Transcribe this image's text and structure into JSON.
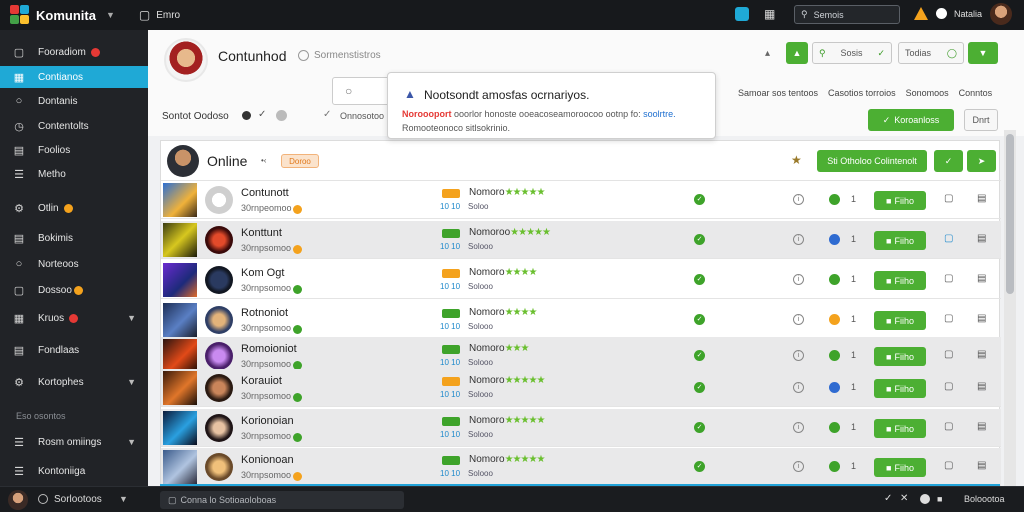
{
  "topbar": {
    "app_title": "Komunita",
    "menu_label": "Emro",
    "search_placeholder": "Semois",
    "user_name": "Natalia"
  },
  "sidebar": {
    "items": [
      {
        "label": "Fooradiom"
      },
      {
        "label": "Contianos"
      },
      {
        "label": "Dontanis"
      },
      {
        "label": "Contentolts"
      },
      {
        "label": "Foolios"
      },
      {
        "label": "Metho"
      },
      {
        "label": "Otlin"
      },
      {
        "label": "Bokimis"
      },
      {
        "label": "Norteoos"
      },
      {
        "label": "Dossoo"
      },
      {
        "label": "Kruos"
      },
      {
        "label": "Fondlaas"
      },
      {
        "label": "Kortophes"
      },
      {
        "label": "Rosm omiings"
      },
      {
        "label": "Kontoniiga"
      }
    ],
    "section_label": "Eso osontos"
  },
  "header": {
    "title": "Contunhod",
    "subtitle": "Sormenstistros",
    "search_label": "Sosis",
    "filter_label": "Todias",
    "tabs": [
      "Samoar sos tentoos",
      "Casotios torroios",
      "Sonomoos",
      "Conntos"
    ],
    "sort_label": "Sontot Oodoso",
    "small_label": "Onnosotoo",
    "action_button": "Koroanloss",
    "secondary_button": "Dnrt"
  },
  "popup": {
    "title": "Nootsondt amosfas ocrnariyos.",
    "line1_red": "Noroooport",
    "line1": "ooorlor honoste ooeacoseamoroocoo ootnp fo:",
    "line1_link": "soolrtre.",
    "line2": "Romooteonoco sitlsokrinio."
  },
  "panel": {
    "title": "Online",
    "pill": "Doroo",
    "add_button": "Sti Otholoo Colintenolt",
    "rows": [
      {
        "name": "Contunott",
        "sub": "30rnpeomoo",
        "label": "Nomoro",
        "stars": "★★★★★",
        "s1": "10 10",
        "s2": "Soloo",
        "num": "1",
        "btn": "Fiiho"
      },
      {
        "name": "Konttunt",
        "sub": "30rnpsomoo",
        "label": "Nomoroo",
        "stars": "★★★★★",
        "s1": "10 10",
        "s2": "Solooo",
        "num": "1",
        "btn": "Fiiho"
      },
      {
        "name": "Kom Ogt",
        "sub": "30rnpsomoo",
        "label": "Nomoro",
        "stars": "★★★★",
        "s1": "10 10",
        "s2": "Solooo",
        "num": "1",
        "btn": "Fiiho"
      },
      {
        "name": "Rotnoniot",
        "sub": "30rnpsomoo",
        "label": "Nomoro",
        "stars": "★★★★",
        "s1": "10 10",
        "s2": "Solooo",
        "num": "1",
        "btn": "Fiiho"
      },
      {
        "name": "Romoioniot",
        "sub": "30rnpsomoo",
        "label": "Nomoro",
        "stars": "★★★",
        "s1": "10 10",
        "s2": "Solooo",
        "num": "1",
        "btn": "Fiiho"
      },
      {
        "name": "Korauiot",
        "sub": "30rnpsomoo",
        "label": "Nomoro",
        "stars": "★★★★★",
        "s1": "10 10",
        "s2": "Solooo",
        "num": "1",
        "btn": "Fiiho"
      },
      {
        "name": "Korionoian",
        "sub": "30rnpsomoo",
        "label": "Nomoro",
        "stars": "★★★★★",
        "s1": "10 10",
        "s2": "Solooo",
        "num": "1",
        "btn": "Fiiho"
      },
      {
        "name": "Konionoan",
        "sub": "30rnpsomoo",
        "label": "Nomoro",
        "stars": "★★★★★",
        "s1": "10 10",
        "s2": "Solooo",
        "num": "1",
        "btn": "Fiiho"
      }
    ]
  },
  "footer": {
    "user": "Sorlootoos",
    "input_placeholder": "Conna lo Sotioaoloboas",
    "right_label": "Boloootoa"
  }
}
